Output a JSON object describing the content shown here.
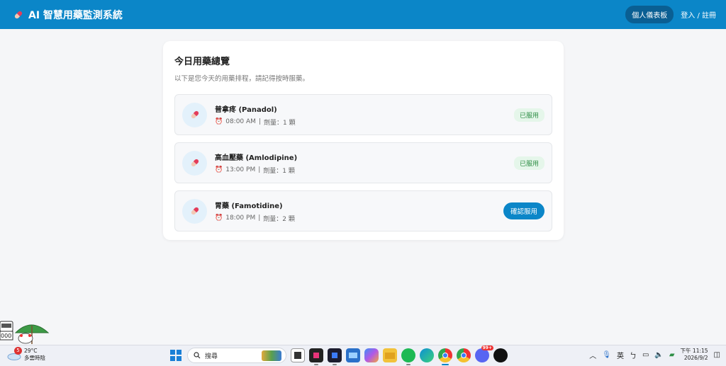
{
  "header": {
    "title": "AI 智慧用藥監測系統",
    "dashboard_label": "個人儀表板",
    "login_label": "登入 / 註冊"
  },
  "main": {
    "title": "今日用藥總覽",
    "subtitle": "以下是您今天的用藥排程，請記得按時服藥。",
    "medications": [
      {
        "name": "普拿疼 (Panadol)",
        "time": "08:00 AM",
        "dose": "劑量：1 顆",
        "status": "已服用",
        "status_type": "taken"
      },
      {
        "name": "高血壓藥 (Amlodipine)",
        "time": "13:00 PM",
        "dose": "劑量：1 顆",
        "status": "已服用",
        "status_type": "taken"
      },
      {
        "name": "胃藥 (Famotidine)",
        "time": "18:00 PM",
        "dose": "劑量：2 顆",
        "status": "確認服用",
        "status_type": "pending"
      }
    ]
  },
  "sticker": {
    "text": "000"
  },
  "taskbar": {
    "weather_badge": "5",
    "weather_temp": "29°C",
    "weather_desc": "多雲時陰",
    "search_placeholder": "搜尋",
    "notification_count": "99+",
    "ime_label": "英",
    "clock_time": "下午 11:15",
    "clock_date": "2026/9/2"
  },
  "colors": {
    "header": "#0b86c8",
    "taken_badge_bg": "#e5f6ea",
    "taken_badge_text": "#2f8f46",
    "confirm_button": "#0b86c8"
  }
}
